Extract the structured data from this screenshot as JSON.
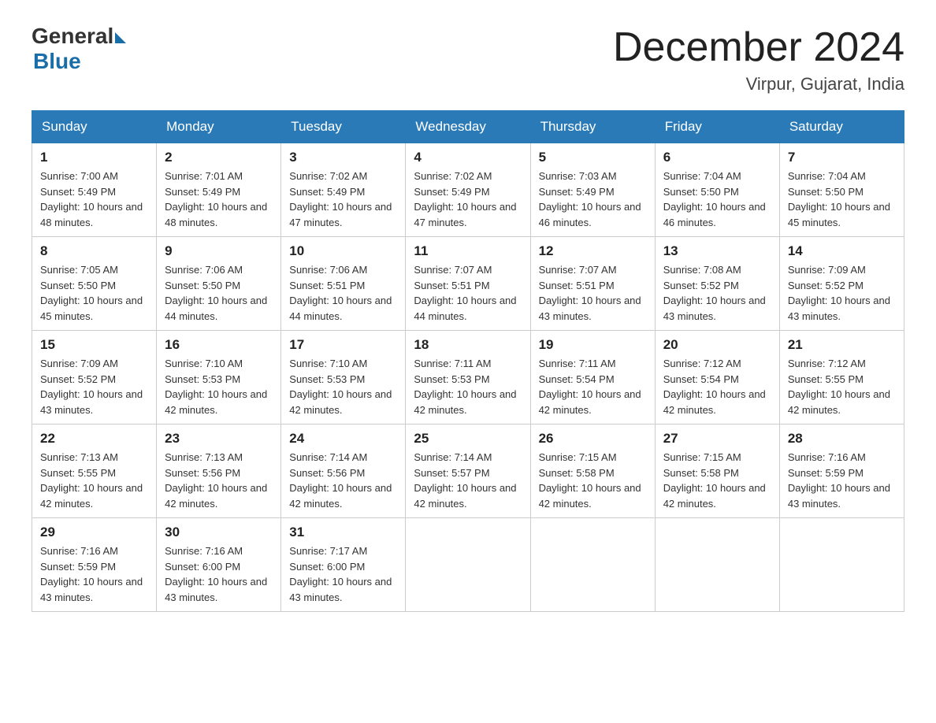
{
  "logo": {
    "general": "General",
    "blue": "Blue"
  },
  "title": "December 2024",
  "location": "Virpur, Gujarat, India",
  "days_of_week": [
    "Sunday",
    "Monday",
    "Tuesday",
    "Wednesday",
    "Thursday",
    "Friday",
    "Saturday"
  ],
  "weeks": [
    [
      {
        "day": "1",
        "sunrise": "7:00 AM",
        "sunset": "5:49 PM",
        "daylight": "10 hours and 48 minutes."
      },
      {
        "day": "2",
        "sunrise": "7:01 AM",
        "sunset": "5:49 PM",
        "daylight": "10 hours and 48 minutes."
      },
      {
        "day": "3",
        "sunrise": "7:02 AM",
        "sunset": "5:49 PM",
        "daylight": "10 hours and 47 minutes."
      },
      {
        "day": "4",
        "sunrise": "7:02 AM",
        "sunset": "5:49 PM",
        "daylight": "10 hours and 47 minutes."
      },
      {
        "day": "5",
        "sunrise": "7:03 AM",
        "sunset": "5:49 PM",
        "daylight": "10 hours and 46 minutes."
      },
      {
        "day": "6",
        "sunrise": "7:04 AM",
        "sunset": "5:50 PM",
        "daylight": "10 hours and 46 minutes."
      },
      {
        "day": "7",
        "sunrise": "7:04 AM",
        "sunset": "5:50 PM",
        "daylight": "10 hours and 45 minutes."
      }
    ],
    [
      {
        "day": "8",
        "sunrise": "7:05 AM",
        "sunset": "5:50 PM",
        "daylight": "10 hours and 45 minutes."
      },
      {
        "day": "9",
        "sunrise": "7:06 AM",
        "sunset": "5:50 PM",
        "daylight": "10 hours and 44 minutes."
      },
      {
        "day": "10",
        "sunrise": "7:06 AM",
        "sunset": "5:51 PM",
        "daylight": "10 hours and 44 minutes."
      },
      {
        "day": "11",
        "sunrise": "7:07 AM",
        "sunset": "5:51 PM",
        "daylight": "10 hours and 44 minutes."
      },
      {
        "day": "12",
        "sunrise": "7:07 AM",
        "sunset": "5:51 PM",
        "daylight": "10 hours and 43 minutes."
      },
      {
        "day": "13",
        "sunrise": "7:08 AM",
        "sunset": "5:52 PM",
        "daylight": "10 hours and 43 minutes."
      },
      {
        "day": "14",
        "sunrise": "7:09 AM",
        "sunset": "5:52 PM",
        "daylight": "10 hours and 43 minutes."
      }
    ],
    [
      {
        "day": "15",
        "sunrise": "7:09 AM",
        "sunset": "5:52 PM",
        "daylight": "10 hours and 43 minutes."
      },
      {
        "day": "16",
        "sunrise": "7:10 AM",
        "sunset": "5:53 PM",
        "daylight": "10 hours and 42 minutes."
      },
      {
        "day": "17",
        "sunrise": "7:10 AM",
        "sunset": "5:53 PM",
        "daylight": "10 hours and 42 minutes."
      },
      {
        "day": "18",
        "sunrise": "7:11 AM",
        "sunset": "5:53 PM",
        "daylight": "10 hours and 42 minutes."
      },
      {
        "day": "19",
        "sunrise": "7:11 AM",
        "sunset": "5:54 PM",
        "daylight": "10 hours and 42 minutes."
      },
      {
        "day": "20",
        "sunrise": "7:12 AM",
        "sunset": "5:54 PM",
        "daylight": "10 hours and 42 minutes."
      },
      {
        "day": "21",
        "sunrise": "7:12 AM",
        "sunset": "5:55 PM",
        "daylight": "10 hours and 42 minutes."
      }
    ],
    [
      {
        "day": "22",
        "sunrise": "7:13 AM",
        "sunset": "5:55 PM",
        "daylight": "10 hours and 42 minutes."
      },
      {
        "day": "23",
        "sunrise": "7:13 AM",
        "sunset": "5:56 PM",
        "daylight": "10 hours and 42 minutes."
      },
      {
        "day": "24",
        "sunrise": "7:14 AM",
        "sunset": "5:56 PM",
        "daylight": "10 hours and 42 minutes."
      },
      {
        "day": "25",
        "sunrise": "7:14 AM",
        "sunset": "5:57 PM",
        "daylight": "10 hours and 42 minutes."
      },
      {
        "day": "26",
        "sunrise": "7:15 AM",
        "sunset": "5:58 PM",
        "daylight": "10 hours and 42 minutes."
      },
      {
        "day": "27",
        "sunrise": "7:15 AM",
        "sunset": "5:58 PM",
        "daylight": "10 hours and 42 minutes."
      },
      {
        "day": "28",
        "sunrise": "7:16 AM",
        "sunset": "5:59 PM",
        "daylight": "10 hours and 43 minutes."
      }
    ],
    [
      {
        "day": "29",
        "sunrise": "7:16 AM",
        "sunset": "5:59 PM",
        "daylight": "10 hours and 43 minutes."
      },
      {
        "day": "30",
        "sunrise": "7:16 AM",
        "sunset": "6:00 PM",
        "daylight": "10 hours and 43 minutes."
      },
      {
        "day": "31",
        "sunrise": "7:17 AM",
        "sunset": "6:00 PM",
        "daylight": "10 hours and 43 minutes."
      },
      null,
      null,
      null,
      null
    ]
  ]
}
